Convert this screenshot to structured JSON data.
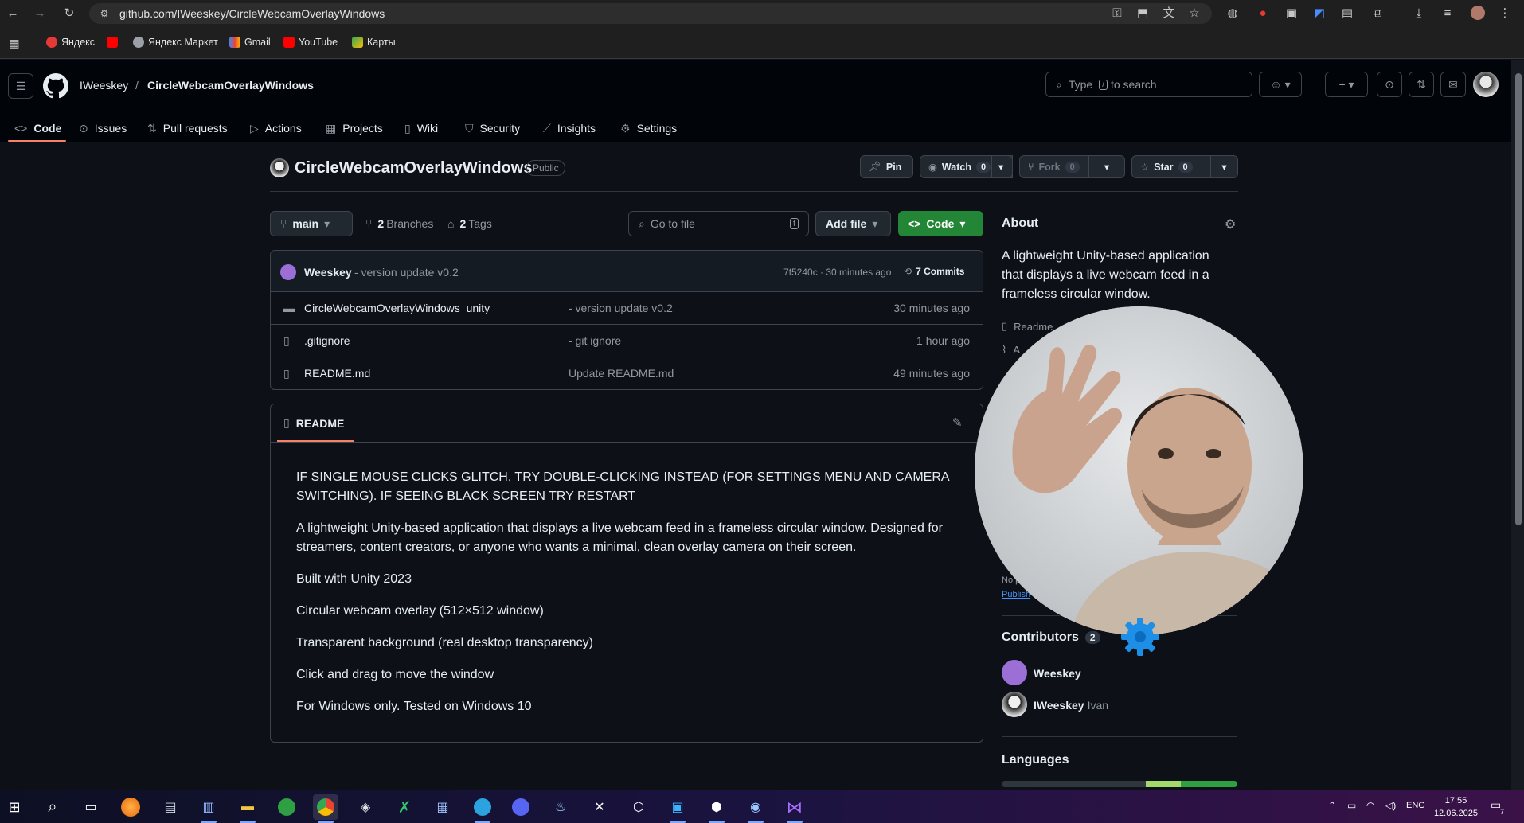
{
  "browser": {
    "url": "github.com/IWeeskey/CircleWebcamOverlayWindows",
    "bookmarks": [
      "Яндекс",
      "Яндекс Маркет",
      "Gmail",
      "YouTube",
      "Карты"
    ]
  },
  "header": {
    "owner": "IWeeskey",
    "separator": "/",
    "repo": "CircleWebcamOverlayWindows",
    "search_placeholder_pre": "Type",
    "search_key": "/",
    "search_placeholder_post": "to search",
    "tabs": [
      {
        "label": "Code",
        "icon": "code-icon"
      },
      {
        "label": "Issues",
        "icon": "issue-icon"
      },
      {
        "label": "Pull requests",
        "icon": "pr-icon"
      },
      {
        "label": "Actions",
        "icon": "play-icon"
      },
      {
        "label": "Projects",
        "icon": "table-icon"
      },
      {
        "label": "Wiki",
        "icon": "book-icon"
      },
      {
        "label": "Security",
        "icon": "shield-icon"
      },
      {
        "label": "Insights",
        "icon": "graph-icon"
      },
      {
        "label": "Settings",
        "icon": "gear-icon"
      }
    ]
  },
  "repo": {
    "title": "CircleWebcamOverlayWindows",
    "visibility": "Public",
    "pin": "Pin",
    "watch": "Watch",
    "watch_count": "0",
    "fork": "Fork",
    "fork_count": "0",
    "star": "Star",
    "star_count": "0"
  },
  "toolbar": {
    "branch": "main",
    "branches_count": "2",
    "branches_label": "Branches",
    "tags_count": "2",
    "tags_label": "Tags",
    "goto_placeholder": "Go to file",
    "goto_key": "t",
    "add_file": "Add file",
    "code": "Code"
  },
  "commit": {
    "author": "Weeskey",
    "message": "- version update v0.2",
    "hash_time": "7f5240c · 30 minutes ago",
    "commits": "7 Commits"
  },
  "files": [
    {
      "name": "CircleWebcamOverlayWindows_unity",
      "message": "- version update v0.2",
      "age": "30 minutes ago",
      "type": "folder"
    },
    {
      "name": ".gitignore",
      "message": "- git ignore",
      "age": "1 hour ago",
      "type": "file"
    },
    {
      "name": "README.md",
      "message": "Update README.md",
      "age": "49 minutes ago",
      "type": "file"
    }
  ],
  "readme": {
    "tab": "README",
    "p1": "IF SINGLE MOUSE CLICKS GLITCH, TRY DOUBLE-CLICKING INSTEAD (FOR SETTINGS MENU AND CAMERA SWITCHING). IF SEEING BLACK SCREEN TRY RESTART",
    "p2": "A lightweight Unity-based application that displays a live webcam feed in a frameless circular window. Designed for streamers, content creators, or anyone who wants a minimal, clean overlay camera on their screen.",
    "p3": "Built with Unity 2023",
    "p4": "Circular webcam overlay (512×512 window)",
    "p5": "Transparent background (real desktop transparency)",
    "p6": "Click and drag to move the window",
    "p7": "For Windows only. Tested on Windows 10"
  },
  "sidebar": {
    "about_title": "About",
    "about_text": "A lightweight Unity-based application that displays a live webcam feed in a frameless circular window.",
    "readme_link": "Readme",
    "activity_link_partial": "A",
    "no_packages_partial": "No p",
    "publish_partial": "Publish",
    "contributors_title": "Contributors",
    "contributors_count": "2",
    "contributors": [
      {
        "login": "Weeskey",
        "name": ""
      },
      {
        "login": "IWeeskey",
        "name": "Ivan"
      }
    ],
    "languages_title": "Languages"
  },
  "taskbar": {
    "lang": "ENG",
    "time": "17:55",
    "date": "12.06.2025",
    "notifications": "7"
  },
  "colors": {
    "accent_green": "#238636",
    "tab_underline": "#f78166",
    "lang_bar": [
      "#30363d",
      "#a5d86b",
      "#2ea043"
    ]
  }
}
